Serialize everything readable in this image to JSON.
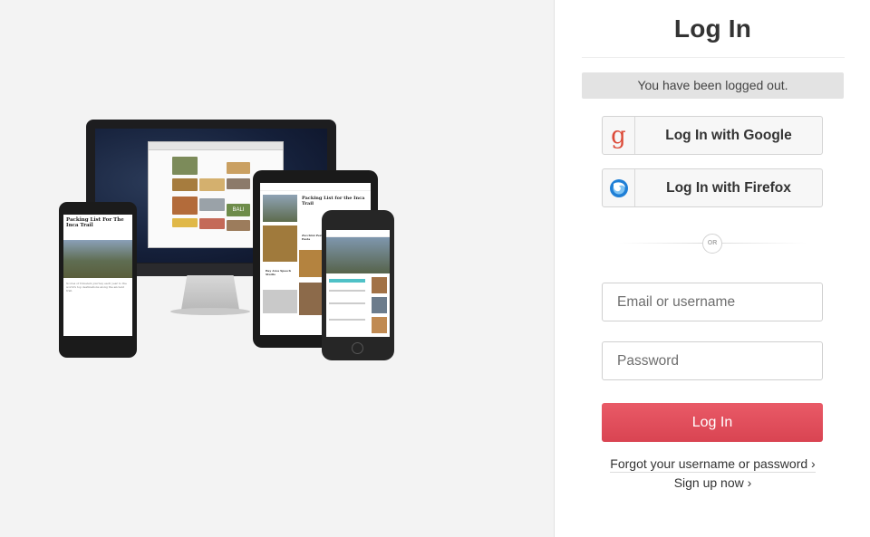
{
  "header": {
    "title": "Log In"
  },
  "notice": {
    "text": "You have been logged out."
  },
  "social": {
    "google_label": "Log In with Google",
    "firefox_label": "Log In with Firefox",
    "google_icon": "google-g-icon",
    "firefox_icon": "firefox-icon"
  },
  "divider": {
    "or_text": "OR"
  },
  "form": {
    "email_placeholder": "Email or username",
    "password_placeholder": "Password",
    "login_label": "Log In"
  },
  "links": {
    "forgot": "Forgot your username or password ›",
    "signup": "Sign up now ›"
  },
  "devices": {
    "article_title": "Packing List For The Inca Trail",
    "tablet_title": "Packing List for the Inca Trail",
    "tablet_item_1": "Zucchini Pesto Pasta",
    "tablet_item_2": "Bay Area Speech Studio",
    "monitor_tile_text": "BALI"
  },
  "colors": {
    "login_button": "#e0505e",
    "google_icon": "#dc4a38",
    "firefox_icon": "#1f7fd6",
    "notice_bg": "#e3e3e3"
  }
}
